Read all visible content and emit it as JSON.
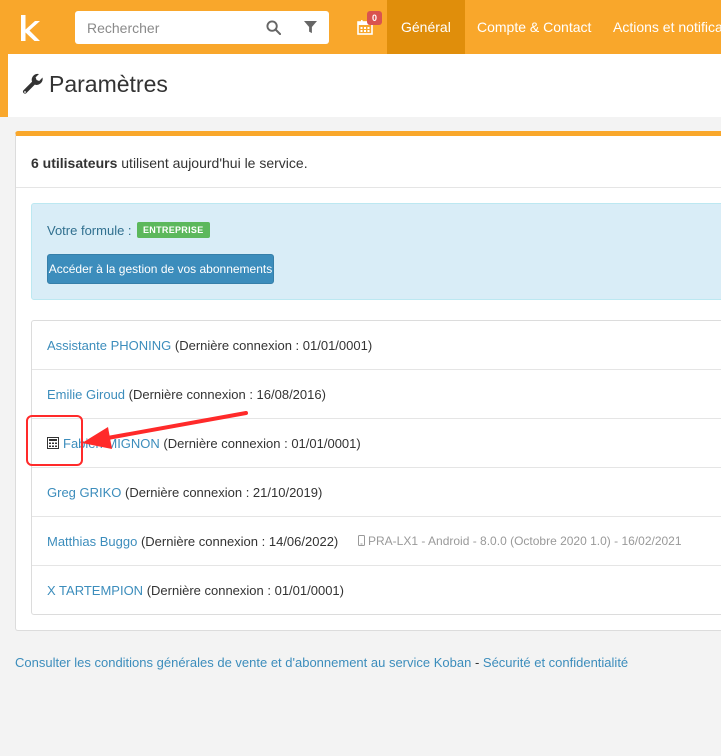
{
  "header": {
    "logo_letter": "k",
    "search_placeholder": "Rechercher",
    "calendar_badge": "0",
    "nav": [
      {
        "label": "Général",
        "active": true
      },
      {
        "label": "Compte & Contact",
        "active": false
      },
      {
        "label": "Actions et notificat",
        "active": false
      }
    ]
  },
  "page": {
    "title": "Paramètres"
  },
  "intro": {
    "count_label": "6 utilisateurs",
    "text": " utilisent aujourd'hui le service."
  },
  "subscription": {
    "formule_label": "Votre formule :",
    "plan_badge": "ENTREPRISE",
    "manage_button": "Accéder à la gestion de vos abonnements"
  },
  "users": [
    {
      "name": "Assistante PHONING",
      "info": " (Dernière connexion : 01/01/0001)",
      "device": ""
    },
    {
      "name": "Emilie Giroud",
      "info": " (Dernière connexion : 16/08/2016)",
      "device": ""
    },
    {
      "name": "Fabien MIGNON",
      "info": " (Dernière connexion : 01/01/0001)",
      "device": "",
      "icon": "calculator-icon"
    },
    {
      "name": "Greg GRIKO",
      "info": " (Dernière connexion : 21/10/2019)",
      "device": ""
    },
    {
      "name": "Matthias Buggo",
      "info": " (Dernière connexion : 14/06/2022)",
      "device": "PRA-LX1 - Android - 8.0.0 (Octobre 2020 1.0) - 16/02/2021"
    },
    {
      "name": "X TARTEMPION",
      "info": " (Dernière connexion : 01/01/0001)",
      "device": ""
    }
  ],
  "footer": {
    "cgv_link": "Consulter les conditions générales de vente et d'abonnement au service Koban",
    "separator": " - ",
    "security_link": "Sécurité et confidentialité"
  },
  "colors": {
    "brand": "#f9a72b",
    "brand_dark": "#e08e0b",
    "link": "#3c8dbc",
    "annotation": "#ff2a2a"
  }
}
